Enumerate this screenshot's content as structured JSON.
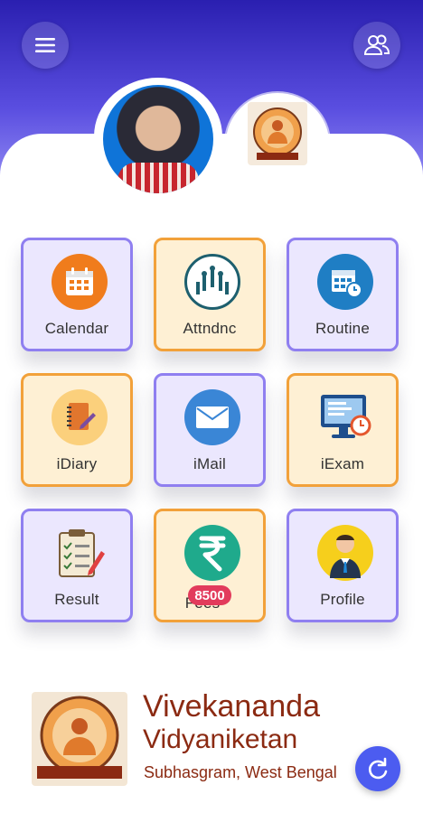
{
  "header": {
    "menu_icon": "hamburger-menu-icon",
    "users_icon": "users-icon"
  },
  "tiles": [
    {
      "label": "Calendar",
      "icon": "calendar-icon",
      "style": "purple"
    },
    {
      "label": "Attndnc",
      "icon": "raised-hands-icon",
      "style": "orange"
    },
    {
      "label": "Routine",
      "icon": "routine-schedule-icon",
      "style": "purple"
    },
    {
      "label": "iDiary",
      "icon": "diary-icon",
      "style": "orange"
    },
    {
      "label": "iMail",
      "icon": "mail-icon",
      "style": "purple"
    },
    {
      "label": "iExam",
      "icon": "exam-monitor-icon",
      "style": "orange"
    },
    {
      "label": "Result",
      "icon": "result-clipboard-icon",
      "style": "purple"
    },
    {
      "label": "Fees",
      "icon": "rupee-icon",
      "style": "orange",
      "badge": "8500"
    },
    {
      "label": "Profile",
      "icon": "profile-person-icon",
      "style": "purple"
    }
  ],
  "school": {
    "name_line1": "Vivekananda",
    "name_line2": "Vidyaniketan",
    "address": "Subhasgram, West Bengal",
    "logo_text": "VIVEKANANDA VIDYANIKETAN",
    "logo_estd": "ESTD - 2000",
    "logo_motto": "Vivekananda Vidyaniketan"
  },
  "colors": {
    "header": "#2a1fb0",
    "tile_purple_border": "#8f7ff0",
    "tile_orange_border": "#f2a13a",
    "school_text": "#8b2a12",
    "refresh_button": "#4c5cf0"
  },
  "refresh_icon": "refresh-icon"
}
